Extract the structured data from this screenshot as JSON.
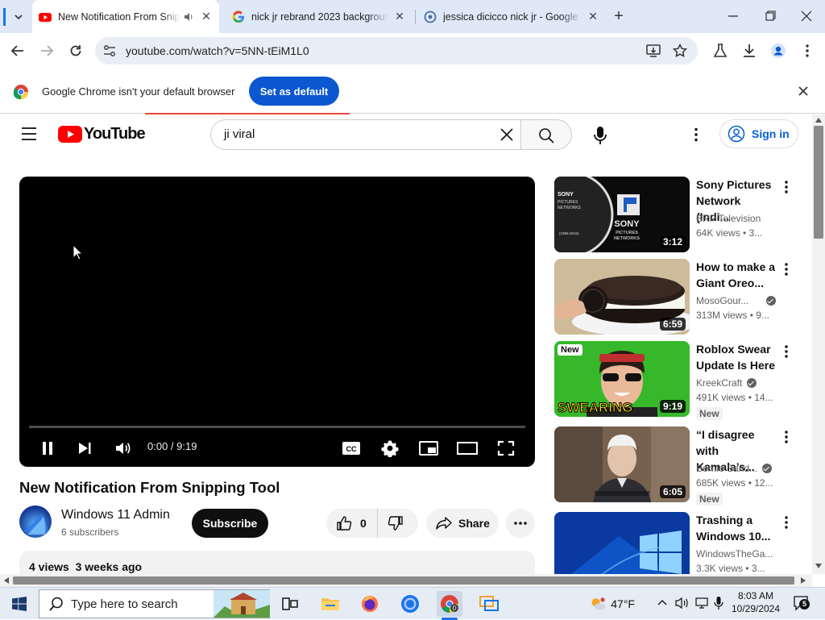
{
  "browser": {
    "tabs": [
      {
        "title": "New Notification From Snipping Tool",
        "active": true
      },
      {
        "title": "nick jr rebrand 2023 background",
        "active": false
      },
      {
        "title": "jessica dicicco nick jr - Google Search",
        "active": false
      }
    ],
    "url": "youtube.com/watch?v=5NN-tEiM1L0"
  },
  "infobar": {
    "message": "Google Chrome isn't your default browser",
    "button": "Set as default"
  },
  "youtube": {
    "logo_text": "YouTube",
    "search_query": "ji viral",
    "sign_in": "Sign in"
  },
  "player": {
    "time": "0:00 / 9:19",
    "progress_fraction": 0.0
  },
  "video": {
    "title": "New Notification From Snipping Tool",
    "channel": "Windows 11 Admin",
    "subscribers": "6 subscribers",
    "subscribe": "Subscribe",
    "likes": "0",
    "share": "Share",
    "meta": "4 views  3 weeks ago"
  },
  "recommendations": [
    {
      "title": "Sony Pictures Network (Indi...",
      "channel": "BRP Television",
      "verified": false,
      "views": "64K views  • 3...",
      "duration": "3:12",
      "new": false,
      "thumb_text": "SONY PICTURES NETWORKS"
    },
    {
      "title": "How to make a Giant Oreo...",
      "channel": "MosoGour...",
      "verified": true,
      "views": "313M views  • 9...",
      "duration": "6:59",
      "new": false,
      "thumb_text": ""
    },
    {
      "title": "Roblox Swear Update Is Here",
      "channel": "KreekCraft",
      "verified": true,
      "views": "491K views  • 14...",
      "duration": "9:19",
      "new": true,
      "thumb_text": "SWEARING"
    },
    {
      "title": "“I disagree with Kamala’s...",
      "channel": "Bernie Sand...",
      "verified": true,
      "views": "685K views  • 12...",
      "duration": "6:05",
      "new": true,
      "thumb_text": ""
    },
    {
      "title": "Trashing a Windows 10...",
      "channel": "WindowsTheGa...",
      "verified": false,
      "views": "3.3K views  • 3...",
      "duration": "",
      "new": false,
      "thumb_text": ""
    }
  ],
  "new_badge": "New",
  "taskbar": {
    "search_placeholder": "Type here to search",
    "weather": "47°F",
    "time": "8:03 AM",
    "date": "10/29/2024",
    "notification_count": "5"
  }
}
